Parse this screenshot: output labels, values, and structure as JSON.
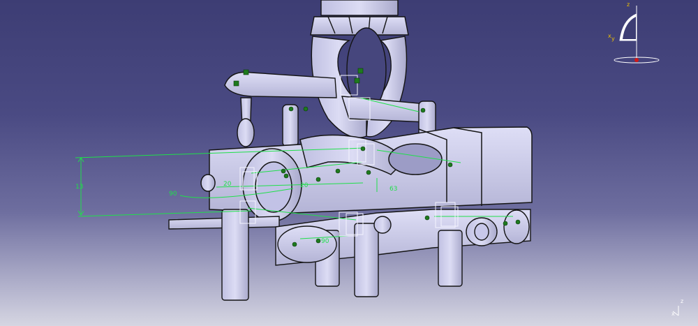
{
  "viewport": {
    "background_top": "#3d3d74",
    "background_bottom": "#d6d6e2",
    "part_fill": "#c9c9ec",
    "part_stroke": "#141414",
    "constraint_color": "#1fe04a",
    "anchor_color": "#1e7a1e"
  },
  "dimensions": {
    "height_value": "13",
    "angle_value": "90",
    "left_note": "20",
    "right_value": "63",
    "center_note": "20",
    "bottom_note": "90"
  },
  "compass": {
    "z_label": "z",
    "x_label": "x",
    "y_label": "y",
    "icons": [
      "compass-icon"
    ]
  },
  "corner_axis": {
    "z_label": "z",
    "x_label": "x"
  }
}
